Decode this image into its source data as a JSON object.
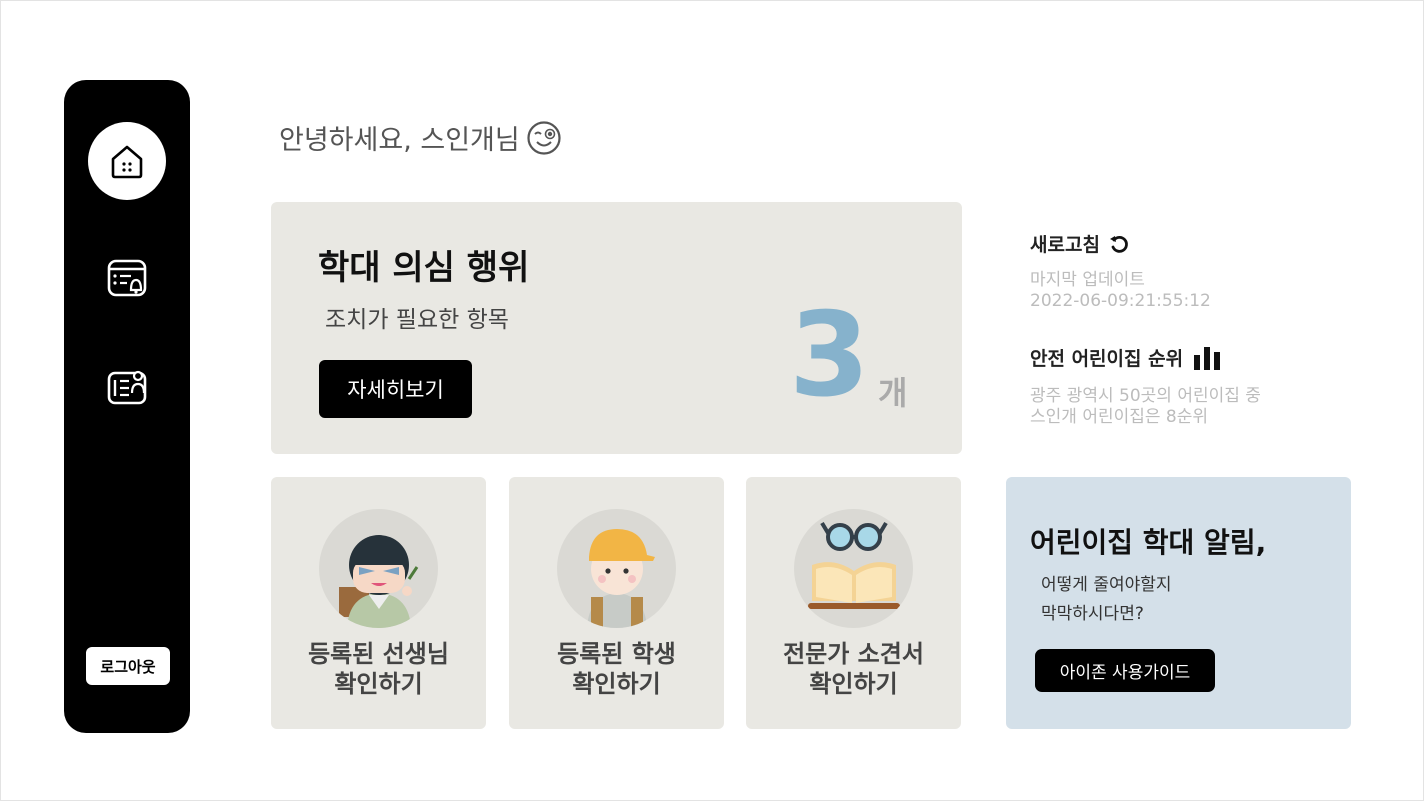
{
  "greeting": {
    "text": "안녕하세요, 스인개님"
  },
  "sidebar": {
    "items": [
      {
        "name": "home",
        "icon": "home-icon"
      },
      {
        "name": "alerts",
        "icon": "alert-list-icon"
      },
      {
        "name": "reports",
        "icon": "report-person-icon"
      }
    ],
    "logout_label": "로그아웃"
  },
  "hero": {
    "title": "학대 의심 행위",
    "subtitle": "조치가 필요한 항목",
    "button_label": "자세히보기",
    "count": "3",
    "unit": "개",
    "count_color": "#86b2cc"
  },
  "refresh": {
    "title": "새로고침",
    "updated_label": "마지막 업데이트",
    "updated_time": "2022-06-09:21:55:12"
  },
  "ranking": {
    "title": "안전 어린이집 순위",
    "line1": "광주 광역시 50곳의 어린이집 중",
    "line2": "스인개 어린이집은 8순위"
  },
  "cards": [
    {
      "line1": "등록된 선생님",
      "line2": "확인하기",
      "icon": "teacher-icon"
    },
    {
      "line1": "등록된 학생",
      "line2": "확인하기",
      "icon": "student-icon"
    },
    {
      "line1": "전문가 소견서",
      "line2": "확인하기",
      "icon": "book-glasses-icon"
    }
  ],
  "guide": {
    "title": "어린이집 학대 알림,",
    "desc1": "어떻게 줄여야할지",
    "desc2": "막막하시다면?",
    "button_label": "아이존 사용가이드",
    "background": "#d4e0e9"
  }
}
